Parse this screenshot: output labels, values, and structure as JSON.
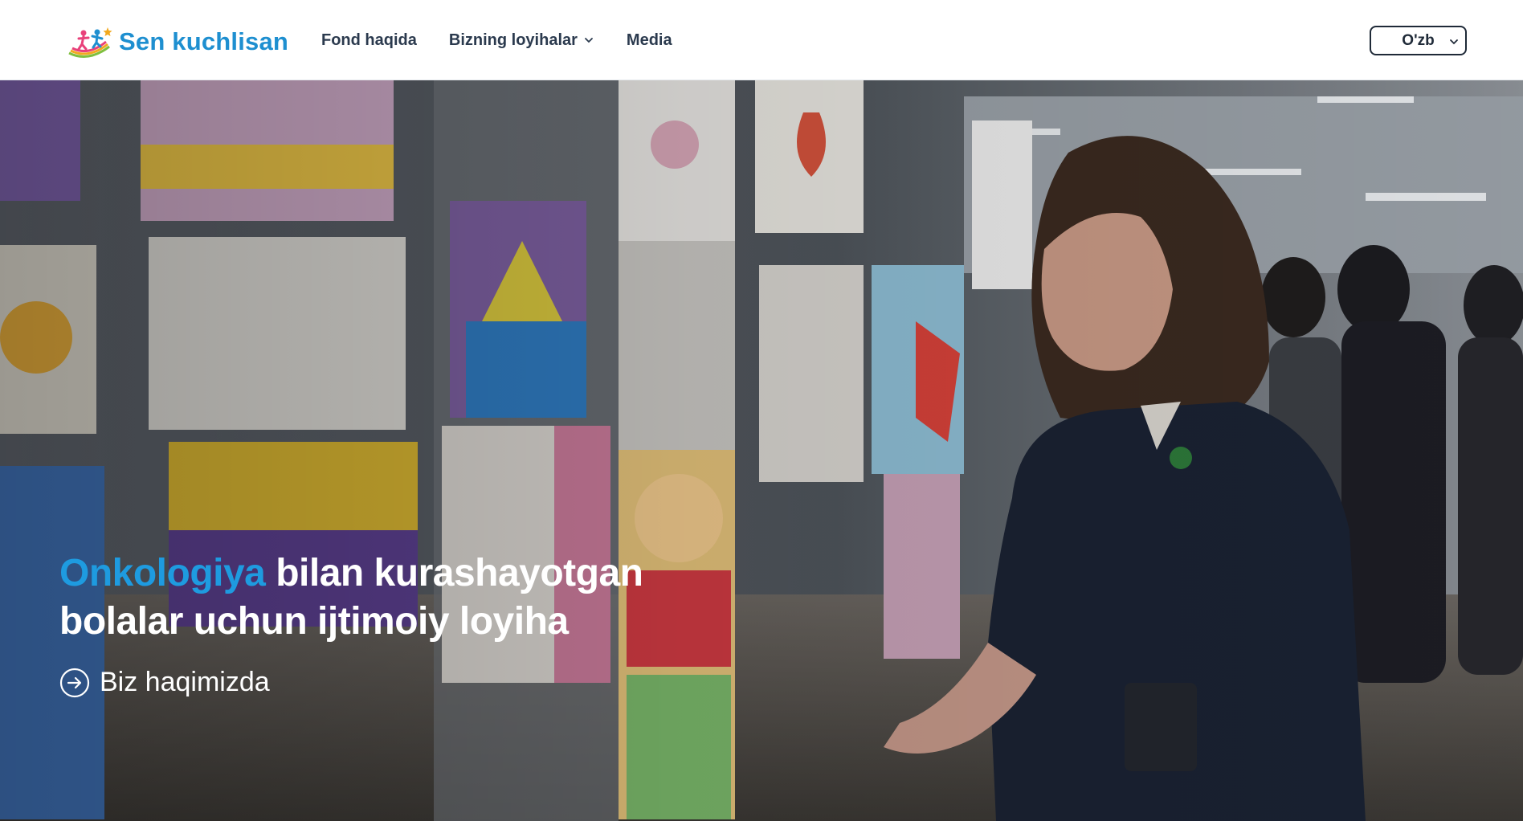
{
  "header": {
    "logo_text": "Sen kuchlisan",
    "nav": [
      {
        "label": "Fond haqida"
      },
      {
        "label": "Bizning loyihalar"
      },
      {
        "label": "Media"
      }
    ],
    "language": "O'zb"
  },
  "hero": {
    "title_accent": "Onkologiya",
    "title_line1_rest": " bilan kurashayotgan",
    "title_line2": "bolalar uchun ijtimoiy loyiha",
    "cta_label": "Biz haqimizda"
  },
  "icons": {
    "chevron": "chevron-down-icon",
    "cta": "arrow-right-circle-icon"
  },
  "colors": {
    "brand": "#1e8fd0",
    "accent": "#1e9be0",
    "nav_text": "#2b3a4e"
  }
}
